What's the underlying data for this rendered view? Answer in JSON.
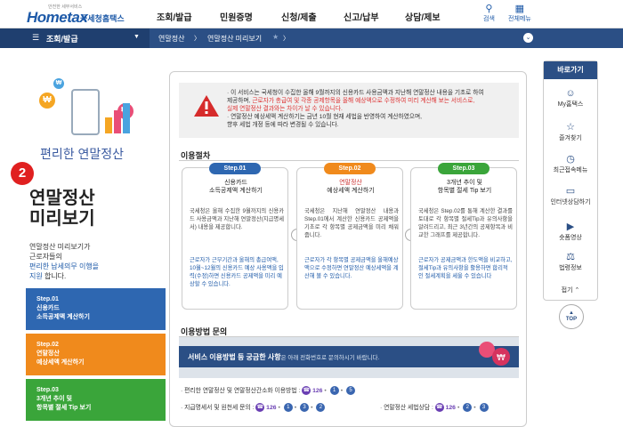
{
  "header": {
    "logo_tagline": "안전한 세무서비스",
    "logo_main": "Hometax",
    "logo_sub": "국세청홈택스",
    "nav": [
      "조회/발급",
      "민원증명",
      "신청/제출",
      "신고/납부",
      "상담/제보"
    ],
    "search_label": "검색",
    "allmenu_label": "전체메뉴"
  },
  "crumb": {
    "menu_label": "조회/발급",
    "item1": "연말정산",
    "item2": "연말정산 미리보기"
  },
  "left": {
    "subtitle": "편리한 연말정산",
    "badge": "2",
    "title_line1": "연말정산",
    "title_line2": "미리보기",
    "desc1": "연말정산 미리보기가",
    "desc2": "근로자들의",
    "desc3_hl": "편리한 납세의무 이행을",
    "desc4a": "지원",
    "desc4b": " 합니다.",
    "steps": [
      {
        "label1": "Step.01",
        "label2": "신용카드",
        "label3": "소득공제액 계산하기",
        "color": "#2e67b1"
      },
      {
        "label1": "Step.02",
        "label2": "연말정산",
        "label3": "예상세액 계산하기",
        "color": "#f08a1c"
      },
      {
        "label1": "Step.03",
        "label2": "3개년 추이 및",
        "label3": "항목별 절세 Tip 보기",
        "color": "#3aa53a"
      }
    ]
  },
  "notice": {
    "l1": "· 이 서비스는 국세청이 수집한 올해 9월까지의 신용카드 사용금액과 지난해 연말정산 내용을 기초로 하여",
    "l2a": "제공하며, ",
    "l2b": "근로자가 총급여 및 각종 공제항목을 올해 예상액으로 수정하여 미리 계산해 보는 서비스로,",
    "l3": "실제 연말정산 결과와는 차이가 날 수 있습니다.",
    "l4": "· 연말정산 예상세액 계산하기는 금년 10월 현재 세법을 반영하여 계산하였으며,",
    "l5": "향후 세법 개정 등에 따라 변경될 수 있습니다."
  },
  "procedure": {
    "title": "이용절차",
    "cards": [
      {
        "pill": "Step.01",
        "pill_color": "#2e67b1",
        "title1": "신용카드",
        "title2": "소득공제액 계산하기",
        "body": "국세청은 올해 수집한 9월까지의 신용카드 사용금액과 지난해 연말정산(지급명세서) 내용을 제공합니다.",
        "note": "근로자가 근무기간과 올해의 총급여액, 10월~12월의 신용카드 예상 사용액을 입력(수정)하면 신용카드 공제액을 미리 예상할 수 있습니다."
      },
      {
        "pill": "Step.02",
        "pill_color": "#f08a1c",
        "title1": "연말정산",
        "title2": "예상세액 계산하기",
        "body": "국세청은 지난해 연말정산 내용과 Step.01에서 계산한 신용카드 공제액을 기초로 각 항목별 공제금액을 미리 채워줍니다.",
        "note": "근로자가 각 항목별 공제금액을 올해예상액으로 수정하면 연말정산 예상세액을 계산해 볼 수 있습니다."
      },
      {
        "pill": "Step.03",
        "pill_color": "#3aa53a",
        "title1": "3개년 추이 및",
        "title2": "항목별 절세 Tip 보기",
        "body": "국세청은 Step.02를 통해 계산한 결과를 토대로 각 항목별 절세Tip과 유의사항을 알려드리고, 최근 3년간의 공제항목과 비교한 그래프를 제공합니다.",
        "note": "근로자가 공제금액과 한도액을 비교하고, 절세Tip과 유의사항을 활용하면 합리적인 절세계획을 세울 수 있습니다"
      }
    ]
  },
  "inquiry": {
    "title": "이용방법 문의",
    "banner_bold": "서비스 이용방법 등 궁금한 사항",
    "banner_rest": "은 아래 전화번호로 문의하시기 바랍니다.",
    "row1_label": "· 편리한 연말정산 및 연말정산간소화 이용방법 :",
    "row2_label": "· 지급명세서 및 원천세 문의 :",
    "row3_label": "· 연말정산 세법상담 :",
    "tel": "126",
    "row1_nums": [
      "1",
      "5"
    ],
    "row2_nums": [
      "1",
      "3",
      "2"
    ],
    "row3_nums": [
      "2",
      "3"
    ]
  },
  "quick": {
    "title": "바로가기",
    "items": [
      "My홈택스",
      "즐겨찾기",
      "최근접속메뉴",
      "인터넷상담하기",
      "숏폼영상",
      "법령정보"
    ],
    "fold": "접기",
    "top": "TOP"
  }
}
